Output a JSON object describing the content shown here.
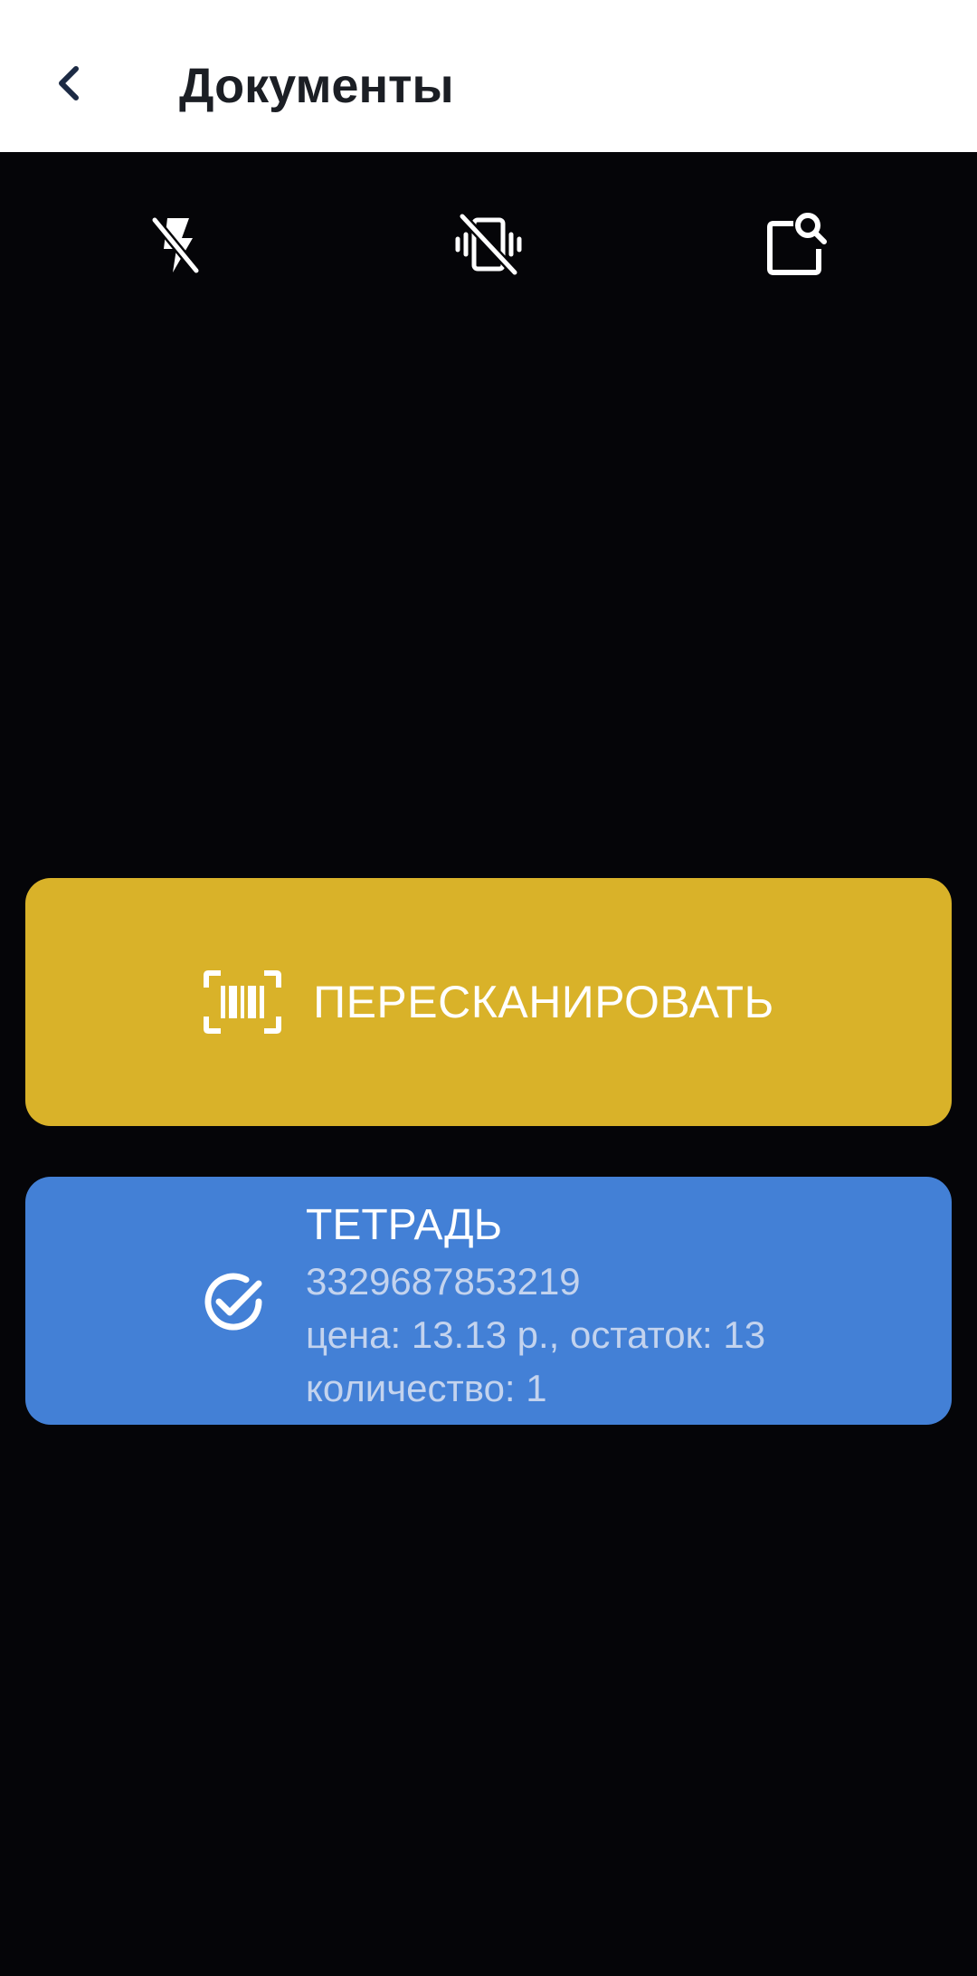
{
  "header": {
    "title": "Документы",
    "back_icon": "chevron-left-icon"
  },
  "camera_toolbar": {
    "buttons": [
      {
        "icon": "flash-off-icon"
      },
      {
        "icon": "vibration-off-icon"
      },
      {
        "icon": "search-screen-icon"
      }
    ]
  },
  "rescan": {
    "label": "ПЕРЕСКАНИРОВАТЬ",
    "icon": "barcode-scan-icon",
    "color": "#d9b229"
  },
  "item": {
    "title": "ТЕТРАДЬ",
    "barcode": "3329687853219",
    "price_stock": "цена: 13.13 р., остаток: 13",
    "quantity": "количество: 1",
    "icon": "check-circle-icon",
    "color": "#4380d6"
  },
  "colors": {
    "appbar_background": "#ffffff",
    "camera_background": "#050508",
    "title_text": "#1b1e24",
    "back_icon": "#1c2a44",
    "secondary_text": "#c3d3ee"
  }
}
